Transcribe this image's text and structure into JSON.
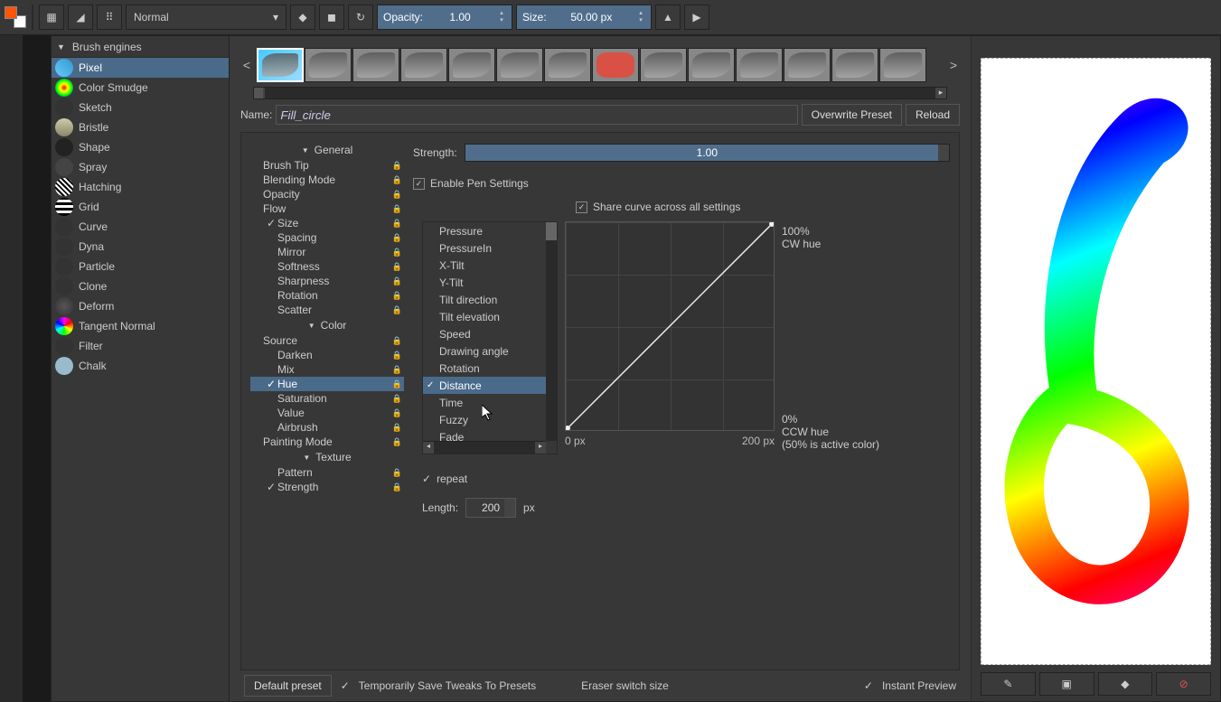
{
  "toolbar": {
    "blend_mode": "Normal",
    "opacity_label": "Opacity:",
    "opacity_value": "1.00",
    "size_label": "Size:",
    "size_value": "50.00 px"
  },
  "engines_header": "Brush engines",
  "engines": [
    {
      "label": "Pixel",
      "icon": "g1",
      "selected": true
    },
    {
      "label": "Color Smudge",
      "icon": "g2"
    },
    {
      "label": "Sketch",
      "icon": "g3"
    },
    {
      "label": "Bristle",
      "icon": "g4"
    },
    {
      "label": "Shape",
      "icon": "g5"
    },
    {
      "label": "Spray",
      "icon": "g6"
    },
    {
      "label": "Hatching",
      "icon": "g7"
    },
    {
      "label": "Grid",
      "icon": "g8"
    },
    {
      "label": "Curve",
      "icon": "g9"
    },
    {
      "label": "Dyna",
      "icon": "g10"
    },
    {
      "label": "Particle",
      "icon": "g11"
    },
    {
      "label": "Clone",
      "icon": "g12"
    },
    {
      "label": "Deform",
      "icon": "g13"
    },
    {
      "label": "Tangent Normal",
      "icon": "g14"
    },
    {
      "label": "Filter",
      "icon": "g15"
    },
    {
      "label": "Chalk",
      "icon": "g16"
    }
  ],
  "name_label": "Name:",
  "preset_name": "Fill_circle",
  "overwrite_btn": "Overwrite Preset",
  "reload_btn": "Reload",
  "option_sections": {
    "general": "General",
    "color": "Color",
    "texture": "Texture"
  },
  "options": {
    "general": [
      {
        "label": "Brush Tip"
      },
      {
        "label": "Blending Mode"
      },
      {
        "label": "Opacity"
      },
      {
        "label": "Flow"
      },
      {
        "label": "Size",
        "checked": true,
        "indent": true
      },
      {
        "label": "Spacing",
        "indent": true
      },
      {
        "label": "Mirror",
        "indent": true
      },
      {
        "label": "Softness",
        "indent": true
      },
      {
        "label": "Sharpness",
        "indent": true
      },
      {
        "label": "Rotation",
        "indent": true
      },
      {
        "label": "Scatter",
        "indent": true
      }
    ],
    "color": [
      {
        "label": "Source"
      },
      {
        "label": "Darken",
        "indent": true
      },
      {
        "label": "Mix",
        "indent": true
      },
      {
        "label": "Hue",
        "indent": true,
        "checked": true,
        "selected": true
      },
      {
        "label": "Saturation",
        "indent": true
      },
      {
        "label": "Value",
        "indent": true
      },
      {
        "label": "Airbrush",
        "indent": true
      },
      {
        "label": "Painting Mode"
      }
    ],
    "texture": [
      {
        "label": "Pattern",
        "indent": true
      },
      {
        "label": "Strength",
        "indent": true,
        "checked": true
      }
    ]
  },
  "strength_label": "Strength:",
  "strength_value": "1.00",
  "enable_pen_label": "Enable Pen Settings",
  "enable_pen_checked": true,
  "share_curve_label": "Share curve across all settings",
  "share_curve_checked": true,
  "sensors": [
    {
      "label": "Pressure"
    },
    {
      "label": "PressureIn"
    },
    {
      "label": "X-Tilt"
    },
    {
      "label": "Y-Tilt"
    },
    {
      "label": "Tilt direction"
    },
    {
      "label": "Tilt elevation"
    },
    {
      "label": "Speed"
    },
    {
      "label": "Drawing angle"
    },
    {
      "label": "Rotation"
    },
    {
      "label": "Distance",
      "checked": true,
      "selected": true
    },
    {
      "label": "Time"
    },
    {
      "label": "Fuzzy"
    },
    {
      "label": "Fade"
    }
  ],
  "curve": {
    "y_top": "100%",
    "y_top2": "CW hue",
    "y_bot": "0%",
    "y_bot2": "CCW hue",
    "y_bot3": "(50% is active color)",
    "x_left": "0 px",
    "x_right": "200 px"
  },
  "repeat_label": "repeat",
  "repeat_checked": true,
  "length_label": "Length:",
  "length_value": "200",
  "length_unit": "px",
  "bottom": {
    "default_preset": "Default preset",
    "temp_save": "Temporarily Save Tweaks To Presets",
    "temp_save_checked": true,
    "eraser_switch": "Eraser switch size",
    "eraser_switch_checked": false,
    "instant_preview": "Instant Preview",
    "instant_preview_checked": true
  }
}
